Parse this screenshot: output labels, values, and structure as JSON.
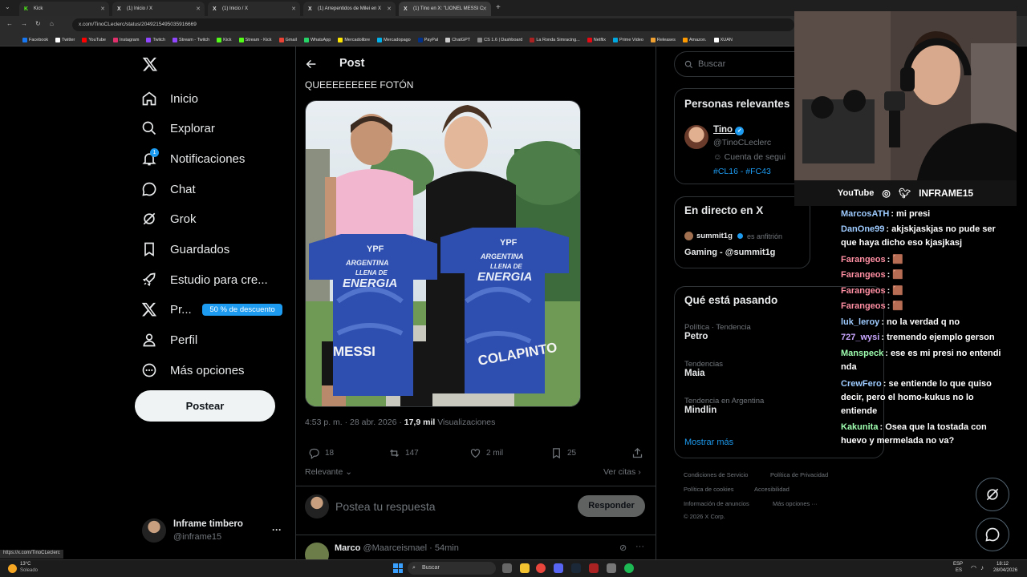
{
  "browser": {
    "tabs": [
      {
        "fav": "K",
        "label": "Kick",
        "color": "#53fc18"
      },
      {
        "fav": "X",
        "label": "(1) Inicio / X",
        "color": "#fff"
      },
      {
        "fav": "X",
        "label": "(1) Inicio / X",
        "color": "#fff"
      },
      {
        "fav": "X",
        "label": "(1) Arrepentidos de Milei en X",
        "color": "#fff"
      },
      {
        "fav": "X",
        "label": "(1) Tino en X: \"LIONEL MESSI C",
        "color": "#fff"
      }
    ],
    "url": "x.com/TinoCLeclerc/status/2049215495035916669",
    "bookmarks": [
      {
        "label": "Facebook",
        "color": "#1877f2"
      },
      {
        "label": "Twitter",
        "color": "#ffffff"
      },
      {
        "label": "YouTube",
        "color": "#ff0000"
      },
      {
        "label": "Instagram",
        "color": "#e1306c"
      },
      {
        "label": "Twitch",
        "color": "#9146ff"
      },
      {
        "label": "Stream - Twitch",
        "color": "#9146ff"
      },
      {
        "label": "Kick",
        "color": "#53fc18"
      },
      {
        "label": "Stream - Kick",
        "color": "#53fc18"
      },
      {
        "label": "Gmail",
        "color": "#ea4335"
      },
      {
        "label": "WhatsApp",
        "color": "#25d366"
      },
      {
        "label": "Mercadolibre",
        "color": "#ffe600"
      },
      {
        "label": "Mercadopago",
        "color": "#00b1ea"
      },
      {
        "label": "PayPal",
        "color": "#003087"
      },
      {
        "label": "ChatGPT",
        "color": "#cccccc"
      },
      {
        "label": "CS 1.6 | Dashboard",
        "color": "#888888"
      },
      {
        "label": "La Ronda Simracing...",
        "color": "#aa2222"
      },
      {
        "label": "Netflix",
        "color": "#e50914"
      },
      {
        "label": "Prime Video",
        "color": "#00a8e1"
      },
      {
        "label": "Releases",
        "color": "#f0a030"
      },
      {
        "label": "Amazon.",
        "color": "#ff9900"
      },
      {
        "label": "XUAN",
        "color": "#ffffff"
      }
    ],
    "status_link": "https://x.com/TinoCLeclerc"
  },
  "nav": {
    "items": [
      "Inicio",
      "Explorar",
      "Notificaciones",
      "Chat",
      "Grok",
      "Guardados",
      "Estudio para cre...",
      "Pr...",
      "Perfil",
      "Más opciones"
    ],
    "notif_count": "1",
    "premium_badge": "50 % de descuento",
    "post_button": "Postear",
    "account_name": "Inframe timbero",
    "account_handle": "@inframe15",
    "more": "···"
  },
  "post": {
    "header": "Post",
    "text": "QUEEEEEEEEE FOTÓN",
    "time": "4:53 p. m. · 28 abr. 2026 · ",
    "views_count": "17,9 mil",
    "views_label": " Visualizaciones",
    "replies": "18",
    "reposts": "147",
    "likes": "2 mil",
    "bookmarks": "25",
    "sort_label": "Relevante",
    "quotes_label": "Ver citas",
    "reply_placeholder": "Postea tu respuesta",
    "reply_button": "Responder",
    "shirt_left_name": "MESSI",
    "shirt_right_name": "COLAPINTO",
    "shirt_brand": "YPF",
    "shirt_slogan_1": "ARGENTINA",
    "shirt_slogan_2": "LLENA DE",
    "shirt_slogan_3": "ENERGIA",
    "next_reply_name": "Marco",
    "next_reply_handle": "@Maarceismael · 54min"
  },
  "sidebar": {
    "search_placeholder": "Buscar",
    "relevant_title": "Personas relevantes",
    "person_name": "Tino",
    "person_handle": "@TinoCLeclerc",
    "person_follows": "Cuenta de segui",
    "person_tags": "#CL16 - #FC43",
    "live_title": "En directo en X",
    "live_user": "summit1g",
    "live_role": "es anfitrión",
    "live_desc": "Gaming - @summit1g",
    "trends_title": "Qué está pasando",
    "trends": [
      {
        "cat": "Política · Tendencia",
        "name": "Petro"
      },
      {
        "cat": "Tendencias",
        "name": "Maia"
      },
      {
        "cat": "Tendencia en Argentina",
        "name": "Mindlin"
      }
    ],
    "show_more": "Mostrar más",
    "footer": [
      "Condiciones de Servicio",
      "Política de Privacidad",
      "Política de cookies",
      "Accesibilidad",
      "Información de anuncios",
      "Más opciones ···",
      "© 2026 X Corp."
    ]
  },
  "stream": {
    "socials": [
      "YouTube",
      "INFRAME15"
    ],
    "chat": [
      {
        "user": "MarcosATH",
        "color": "#9ecbff",
        "msg": "mi presi"
      },
      {
        "user": "DanOne99",
        "color": "#9ecbff",
        "msg": "akjskjaskjas no pude ser que haya dicho eso kjasjkasj"
      },
      {
        "user": "Farangeos",
        "color": "#ff8fa3",
        "msg": "🟫"
      },
      {
        "user": "Farangeos",
        "color": "#ff8fa3",
        "msg": "🟫"
      },
      {
        "user": "Farangeos",
        "color": "#ff8fa3",
        "msg": "🟫"
      },
      {
        "user": "Farangeos",
        "color": "#ff8fa3",
        "msg": "🟫"
      },
      {
        "user": "luk_leroy",
        "color": "#9ecbff",
        "msg": "no la verdad q no"
      },
      {
        "user": "727_wysi",
        "color": "#c9a7ff",
        "msg": "tremendo ejemplo gerson"
      },
      {
        "user": "Manspeck",
        "color": "#9fffb0",
        "msg": "ese es mi presi no entendi nda"
      },
      {
        "user": "CrewFero",
        "color": "#9ecbff",
        "msg": "se entiende lo que quiso decir, pero el homo-kukus no lo entiende"
      },
      {
        "user": "Kakunita",
        "color": "#9fffb0",
        "msg": "Osea que la tostada con huevo y mermelada no va?"
      }
    ]
  },
  "taskbar": {
    "weather_temp": "13°C",
    "weather_desc": "Soleado",
    "search": "Buscar",
    "lang1": "ESP",
    "lang2": "ES",
    "time": "18:12",
    "date": "28/04/2026"
  },
  "colors": {
    "accent": "#1d9bf0",
    "bg": "#000000",
    "text": "#e7e9ea",
    "muted": "#71767b"
  }
}
